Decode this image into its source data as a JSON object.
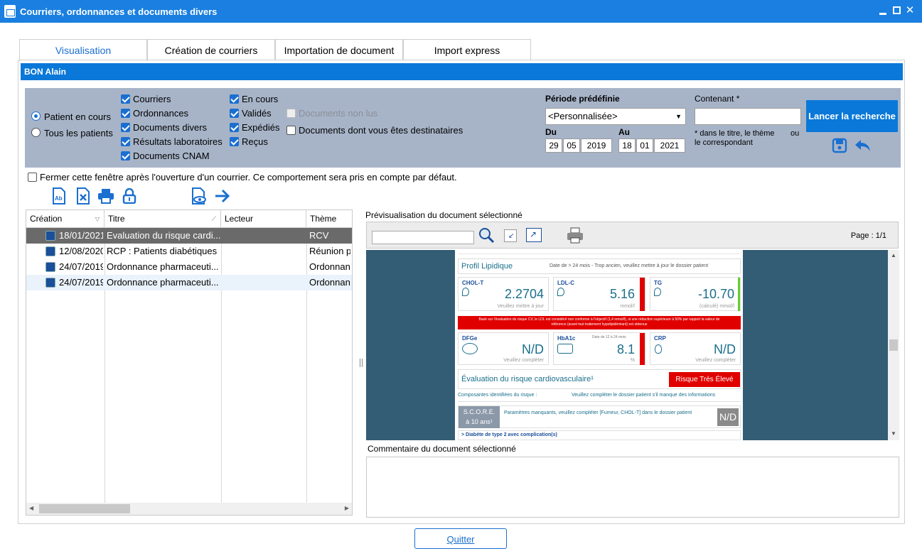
{
  "window": {
    "title": "Courriers, ordonnances et documents divers",
    "controls": [
      "minimize-icon",
      "maximize-icon",
      "close-icon"
    ]
  },
  "tabs": [
    {
      "label": "Visualisation",
      "active": true
    },
    {
      "label": "Création de courriers",
      "active": false
    },
    {
      "label": "Importation de document",
      "active": false
    },
    {
      "label": "Import express",
      "active": false
    }
  ],
  "patient_bar": {
    "name": "BON Alain"
  },
  "filters": {
    "scope": [
      {
        "label": "Patient en cours",
        "selected": true
      },
      {
        "label": "Tous les patients",
        "selected": false
      }
    ],
    "types": [
      {
        "label": "Courriers",
        "checked": true
      },
      {
        "label": "Ordonnances",
        "checked": true
      },
      {
        "label": "Documents divers",
        "checked": true
      },
      {
        "label": "Résultats laboratoires",
        "checked": true
      },
      {
        "label": "Documents CNAM",
        "checked": true
      }
    ],
    "statuses": [
      {
        "label": "En cours",
        "checked": true
      },
      {
        "label": "Validés",
        "checked": true
      },
      {
        "label": "Expédiés",
        "checked": true
      },
      {
        "label": "Reçus",
        "checked": true
      }
    ],
    "extra": [
      {
        "label": "Documents non lus",
        "checked": false,
        "disabled": true
      },
      {
        "label": "Documents dont vous êtes destinataires",
        "checked": false,
        "disabled": false
      }
    ],
    "period_label": "Période prédéfinie",
    "period_value": "<Personnalisée>",
    "from_label": "Du",
    "from": {
      "day": "29",
      "month": "05",
      "year": "2019"
    },
    "to_label": "Au",
    "to": {
      "day": "18",
      "month": "01",
      "year": "2021"
    },
    "containing_label": "Contenant *",
    "containing_value": "",
    "containing_hint_1": "* dans le titre, le thème",
    "containing_hint_or": "ou",
    "containing_hint_2": "le correspondant",
    "search_button": "Lancer la recherche"
  },
  "close_after_open": {
    "checked": false,
    "label": "Fermer cette fenêtre après l'ouverture d'un courrier. Ce comportement sera pris en compte par défaut."
  },
  "document_table": {
    "columns": [
      "Création",
      "Titre",
      "Lecteur",
      "Thème"
    ],
    "rows": [
      {
        "date": "18/01/2021",
        "title": "Evaluation du risque cardi...",
        "reader": "",
        "theme": "RCV",
        "selected": true
      },
      {
        "date": "12/08/2020",
        "title": "RCP : Patients diabétiques",
        "reader": "",
        "theme": "Réunion p",
        "selected": false
      },
      {
        "date": "24/07/2019",
        "title": "Ordonnance pharmaceuti...",
        "reader": "",
        "theme": "Ordonnanc",
        "selected": false
      },
      {
        "date": "24/07/2019",
        "title": "Ordonnance pharmaceuti...",
        "reader": "",
        "theme": "Ordonnanc",
        "selected": false
      }
    ]
  },
  "preview": {
    "label": "Prévisualisation du document sélectionné",
    "page_indicator": "Page : 1/1",
    "doc": {
      "lipid_title": "Profil Lipidique",
      "lipid_warning": "Date de > 24 mois - Trop ancien, veuillez mettre à jour le dossier patient",
      "cards_row1": [
        {
          "label": "CHOL-T",
          "value": "2.2704",
          "sub": "Veuillez mettre à jour"
        },
        {
          "label": "LDL-C",
          "value": "5.16",
          "sub": "mmol/l"
        },
        {
          "label": "TG",
          "value": "-10.70",
          "sub": "(calculé) mmol/l"
        }
      ],
      "alert_text": "Basé sur l'évaluation du risque CV, le LDL est considéré non conforme à l'objectif (1,4 mmol/l), si une réduction supérieure à 50% par rapport la valeur de référence (avant tout traitement hypolipidémiant) est obtenue",
      "cards_row2": [
        {
          "label": "DFGe",
          "value": "N/D",
          "sub": "Veuillez compléter",
          "note": ""
        },
        {
          "label": "HbA1c",
          "value": "8.1",
          "sub": "%",
          "note": "Date de 12 à 24 mois"
        },
        {
          "label": "CRP",
          "value": "N/D",
          "sub": "Veuillez compléter",
          "note": ""
        }
      ],
      "risk_title": "Évaluation du risque cardiovasculaire¹",
      "risk_badge": "Risque Très Élevé",
      "components_label": "Composantes identifiées du risque :",
      "components_warning": "Veuillez compléter le dossier patient s'il manque des informations",
      "score_label_1": "S.C.O.R.E.",
      "score_label_2": "à 10 ans¹",
      "score_text": "Paramètres manquants, veuillez compléter [Fumeur, CHOL-T] dans le dossier patient",
      "score_value": "N/D",
      "diabetes_line": ">  Diabète de type 2 avec complication(s)"
    }
  },
  "comment": {
    "label": "Commentaire du document sélectionné",
    "value": ""
  },
  "quit_button": "Quitter",
  "colors": {
    "titlebar": "#1a7fe0",
    "accent": "#0a78d8",
    "panel": "#a7b4c8",
    "preview_bg": "#335d74",
    "alert": "#e00000"
  }
}
